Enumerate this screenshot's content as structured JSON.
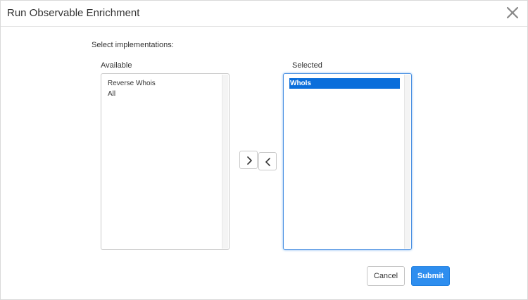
{
  "dialog": {
    "title": "Run Observable Enrichment",
    "close_icon": "close-icon"
  },
  "form": {
    "prompt": "Select implementations:",
    "available_label": "Available",
    "selected_label": "Selected",
    "available_items": [
      "Reverse Whois",
      "All"
    ],
    "selected_items": [
      "WhoIs"
    ],
    "move_right_icon": "chevron-right-icon",
    "move_left_icon": "chevron-left-icon"
  },
  "buttons": {
    "cancel": "Cancel",
    "submit": "Submit"
  },
  "colors": {
    "accent": "#2e8eef",
    "selection": "#0a6edb"
  }
}
